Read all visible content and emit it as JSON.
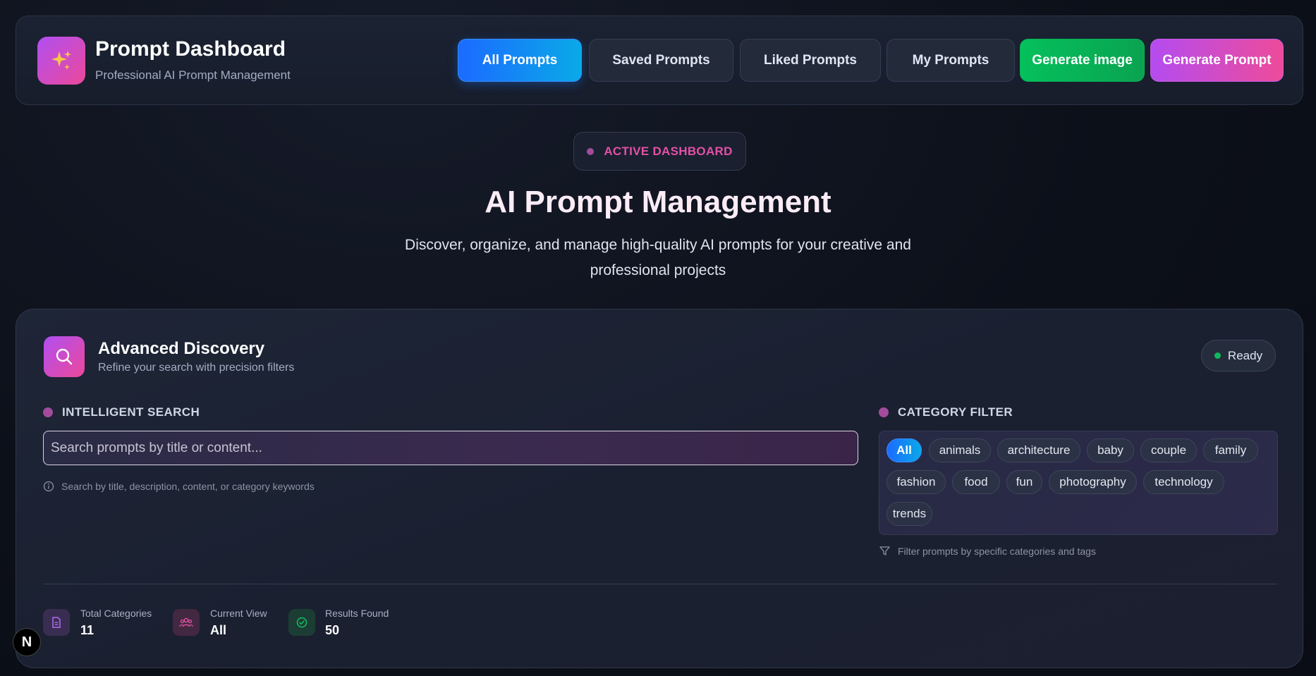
{
  "header": {
    "title": "Prompt Dashboard",
    "subtitle": "Professional AI Prompt Management",
    "logo_icon": "sparkles-icon",
    "nav": [
      {
        "label": "All Prompts",
        "active": true
      },
      {
        "label": "Saved Prompts",
        "active": false
      },
      {
        "label": "Liked Prompts",
        "active": false
      },
      {
        "label": "My Prompts",
        "active": false
      }
    ],
    "generate_image_label": "Generate image",
    "generate_prompt_label": "Generate Prompt"
  },
  "hero": {
    "badge": "ACTIVE DASHBOARD",
    "title": "AI Prompt Management",
    "description": "Discover, organize, and manage high-quality AI prompts for your creative and professional projects"
  },
  "discovery": {
    "title": "Advanced Discovery",
    "subtitle": "Refine your search with precision filters",
    "status": "Ready",
    "search": {
      "label": "INTELLIGENT SEARCH",
      "placeholder": "Search prompts by title or content...",
      "value": "",
      "hint": "Search by title, description, content, or category keywords"
    },
    "category": {
      "label": "CATEGORY FILTER",
      "chips": [
        "All",
        "animals",
        "architecture",
        "baby",
        "couple",
        "family",
        "fashion",
        "food",
        "fun",
        "photography",
        "technology",
        "trends"
      ],
      "selected": "All",
      "hint": "Filter prompts by specific categories and tags"
    },
    "stats": [
      {
        "label": "Total Categories",
        "value": "11",
        "icon": "document-icon"
      },
      {
        "label": "Current View",
        "value": "All",
        "icon": "users-icon"
      },
      {
        "label": "Results Found",
        "value": "50",
        "icon": "check-circle-icon"
      }
    ]
  },
  "colors": {
    "accent_blue": "#1b6bff",
    "accent_pink": "#ec4899",
    "accent_purple": "#b04ff2",
    "accent_green": "#05c05b"
  },
  "dev_badge": "N"
}
